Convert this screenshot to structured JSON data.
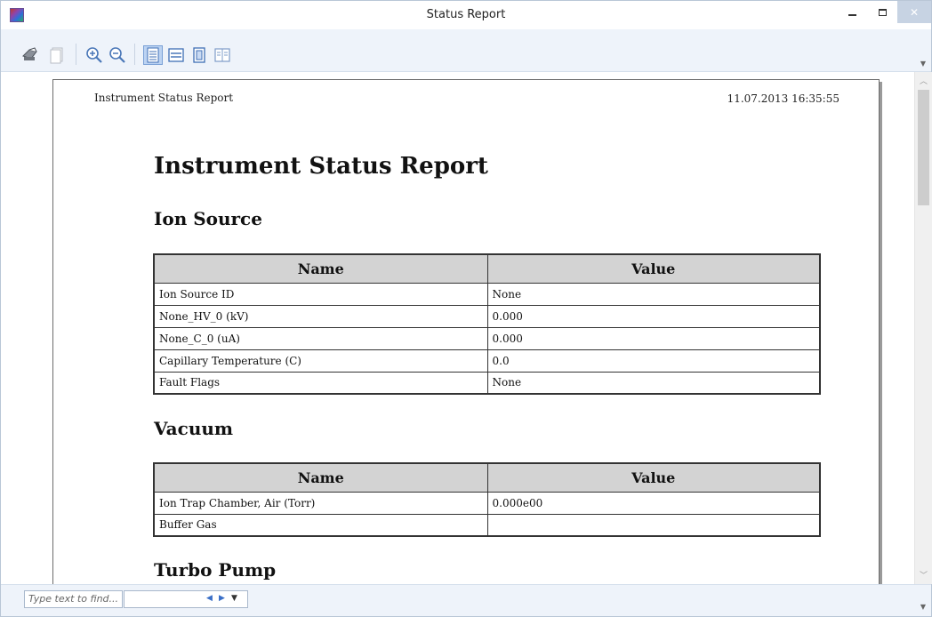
{
  "window": {
    "title": "Status Report",
    "close_glyph": "✕"
  },
  "toolbar": {
    "buttons": [
      {
        "name": "print-icon"
      },
      {
        "name": "copy-icon"
      },
      {
        "name": "zoom-in-icon"
      },
      {
        "name": "zoom-out-icon"
      },
      {
        "name": "whole-page-icon",
        "active": true
      },
      {
        "name": "page-width-icon"
      },
      {
        "name": "single-page-icon"
      },
      {
        "name": "two-pages-icon"
      }
    ]
  },
  "report": {
    "header_left": "Instrument Status Report",
    "header_right": "11.07.2013 16:35:55",
    "title": "Instrument Status Report",
    "sections": {
      "ion_source": {
        "title": "Ion Source",
        "columns": [
          "Name",
          "Value"
        ],
        "rows": [
          [
            "Ion Source ID",
            "None"
          ],
          [
            "None_HV_0 (kV)",
            "0.000"
          ],
          [
            "None_C_0 (uA)",
            "0.000"
          ],
          [
            "Capillary Temperature (C)",
            "0.0"
          ],
          [
            "Fault Flags",
            "None"
          ]
        ]
      },
      "vacuum": {
        "title": "Vacuum",
        "columns": [
          "Name",
          "Value"
        ],
        "rows": [
          [
            "Ion Trap Chamber, Air (Torr)",
            "0.000e00"
          ],
          [
            "Buffer Gas",
            ""
          ]
        ]
      },
      "turbo_pump": {
        "title": "Turbo Pump"
      }
    }
  },
  "findbar": {
    "placeholder": "Type text to find..."
  },
  "colors": {
    "table_header_bg": "#d3d3d3",
    "close_button_bg": "#c7d3e3",
    "toolbar_bg": "#eef3fa"
  }
}
